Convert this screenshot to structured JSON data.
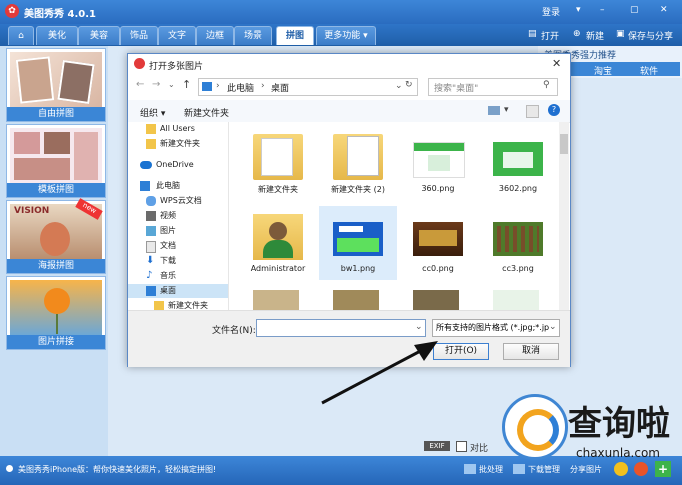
{
  "app": {
    "title": "美图秀秀 4.0.1",
    "login": "登录",
    "window_controls": [
      "▾",
      "–",
      "▢",
      "✕"
    ]
  },
  "tabs": [
    {
      "label": "美化"
    },
    {
      "label": "美容"
    },
    {
      "label": "饰品"
    },
    {
      "label": "文字"
    },
    {
      "label": "边框"
    },
    {
      "label": "场景"
    },
    {
      "label": "拼图",
      "active": true
    },
    {
      "label": "更多功能 ▾"
    }
  ],
  "toolbar": {
    "open": "打开",
    "new": "新建",
    "save_share": "保存与分享"
  },
  "right_panel": {
    "promo": "美图秀秀强力推荐",
    "tab1": "淘宝",
    "tab2": "软件"
  },
  "left_cards": [
    {
      "label": "自由拼图"
    },
    {
      "label": "模板拼图"
    },
    {
      "label": "海报拼图"
    },
    {
      "label": "图片拼接"
    }
  ],
  "dialog": {
    "title": "打开多张图片",
    "path": [
      "此电脑",
      "桌面"
    ],
    "search_placeholder": "搜索\"桌面\"",
    "organize": "组织 ▾",
    "new_folder": "新建文件夹",
    "nav_items": [
      {
        "label": "All Users",
        "icon": "folder-icon"
      },
      {
        "label": "新建文件夹",
        "icon": "folder-icon"
      },
      {
        "label": "OneDrive",
        "icon": "cloud-icon"
      },
      {
        "label": "此电脑",
        "icon": "computer-icon"
      },
      {
        "label": "WPS云文档",
        "icon": "wps-cloud-icon"
      },
      {
        "label": "视频",
        "icon": "video-icon"
      },
      {
        "label": "图片",
        "icon": "picture-icon"
      },
      {
        "label": "文档",
        "icon": "document-icon"
      },
      {
        "label": "下载",
        "icon": "download-icon"
      },
      {
        "label": "音乐",
        "icon": "music-icon"
      },
      {
        "label": "桌面",
        "icon": "desktop-icon",
        "selected": true
      },
      {
        "label": "新建文件夹",
        "icon": "folder-icon"
      }
    ],
    "files": [
      {
        "name": "新建文件夹",
        "kind": "folder"
      },
      {
        "name": "新建文件夹 (2)",
        "kind": "folder-doc"
      },
      {
        "name": "360.png",
        "kind": "green-shot"
      },
      {
        "name": "3602.png",
        "kind": "green-flat"
      },
      {
        "name": "Administrator",
        "kind": "user"
      },
      {
        "name": "bw1.png",
        "kind": "blue-game",
        "selected": true
      },
      {
        "name": "cc0.png",
        "kind": "sanguo"
      },
      {
        "name": "cc3.png",
        "kind": "battle"
      }
    ],
    "filename_label": "文件名(N):",
    "filename_value": "",
    "filetype": "所有支持的图片格式 (*.jpg;*.jp",
    "open_button": "打开(O)",
    "cancel_button": "取消"
  },
  "canvas_controls": {
    "exif": "EXIF",
    "compare": "对比"
  },
  "statusbar": {
    "message": "美图秀秀iPhone版：帮你快速美化照片，轻松搞定拼图!",
    "batch": "批处理",
    "download_mgr": "下载管理",
    "share_pic": "分享图片"
  },
  "watermark": {
    "text": "查询啦",
    "url": "chaxunla.com"
  },
  "colors": {
    "accent": "#2a6cc0",
    "tab_active_text": "#1f5ea8"
  }
}
